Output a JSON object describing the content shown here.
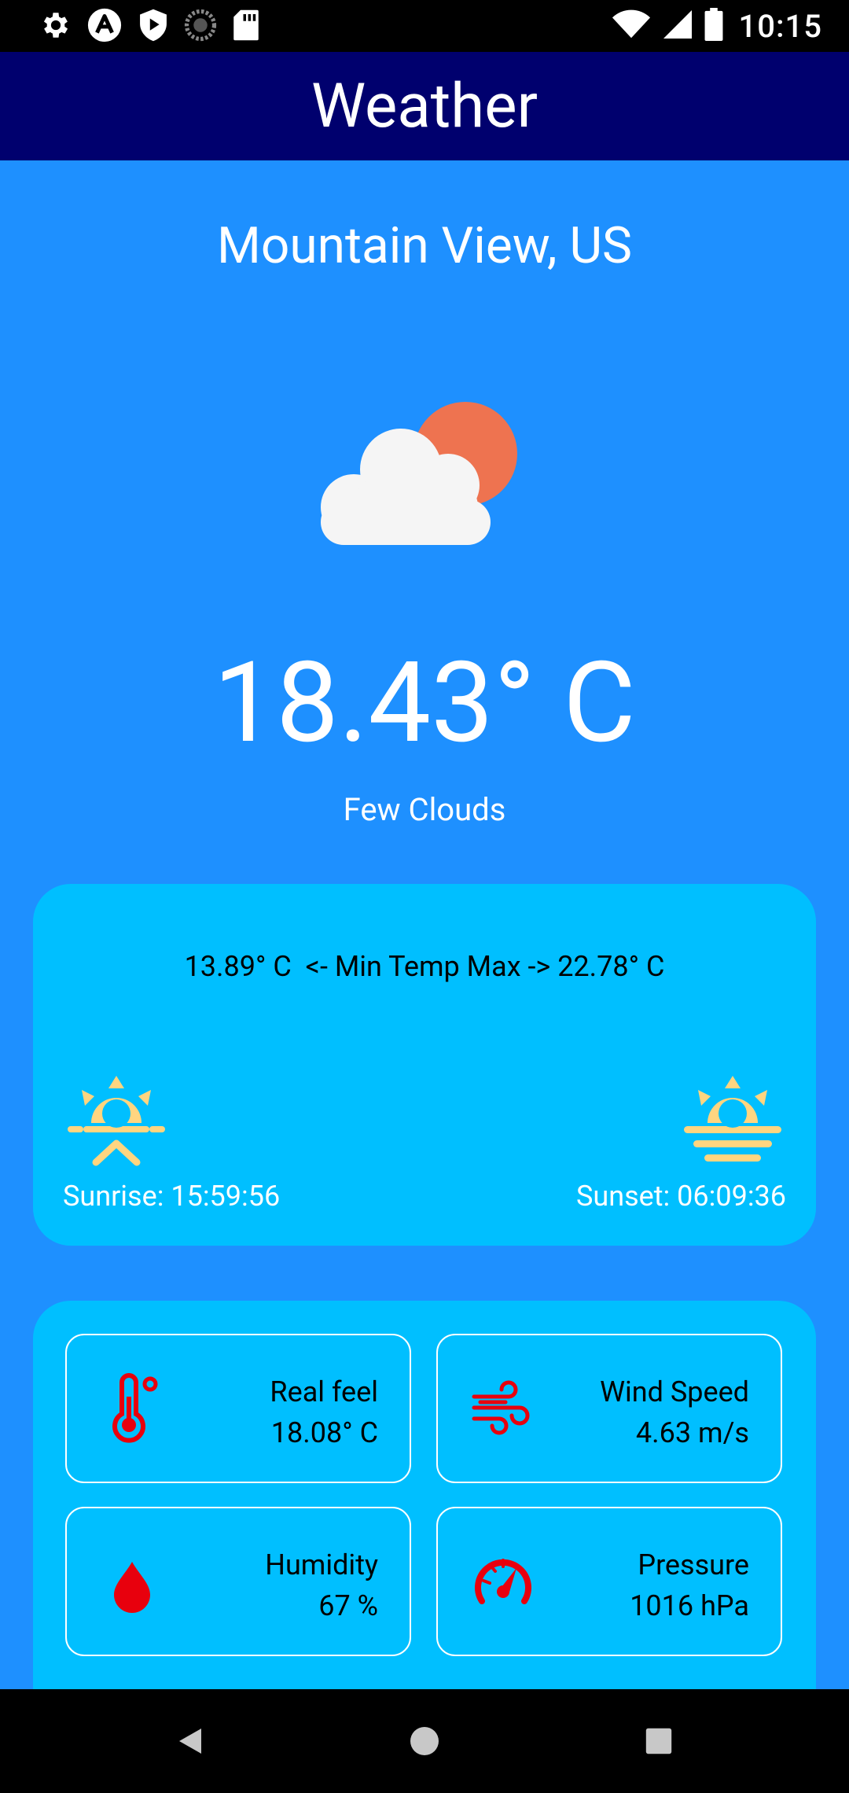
{
  "status_bar": {
    "time": "10:15",
    "left_icons": [
      "gear-icon",
      "autofill-icon",
      "play-protect-icon",
      "loading-circle-icon",
      "sd-card-icon"
    ],
    "right_icons": [
      "wifi-icon",
      "signal-icon",
      "battery-icon"
    ]
  },
  "app_bar": {
    "title": "Weather"
  },
  "location": {
    "city": "Mountain View, US"
  },
  "current": {
    "icon": "few-clouds-icon",
    "temperature": "18.43° C",
    "description": "Few Clouds"
  },
  "summary_card": {
    "min_max": "13.89° C  <- Min Temp Max -> 22.78° C",
    "sunrise": "Sunrise: 15:59:56",
    "sunset": "Sunset: 06:09:36"
  },
  "details": [
    {
      "icon": "thermometer-icon",
      "label": "Real feel",
      "value": "18.08° C"
    },
    {
      "icon": "wind-icon",
      "label": "Wind Speed",
      "value": "4.63 m/s"
    },
    {
      "icon": "water-drop-icon",
      "label": "Humidity",
      "value": "67 %"
    },
    {
      "icon": "gauge-icon",
      "label": "Pressure",
      "value": "1016 hPa"
    }
  ],
  "colors": {
    "background": "#1E90FF",
    "app_bar": "#00006E",
    "card": "#00BFFF",
    "sun": "#FFD580",
    "detail_icon": "#E8000D",
    "cloud": "#F5F5F5",
    "sun_disc": "#EE7350"
  },
  "nav_bar": {
    "buttons": [
      "back-icon",
      "home-icon",
      "recents-icon"
    ]
  }
}
